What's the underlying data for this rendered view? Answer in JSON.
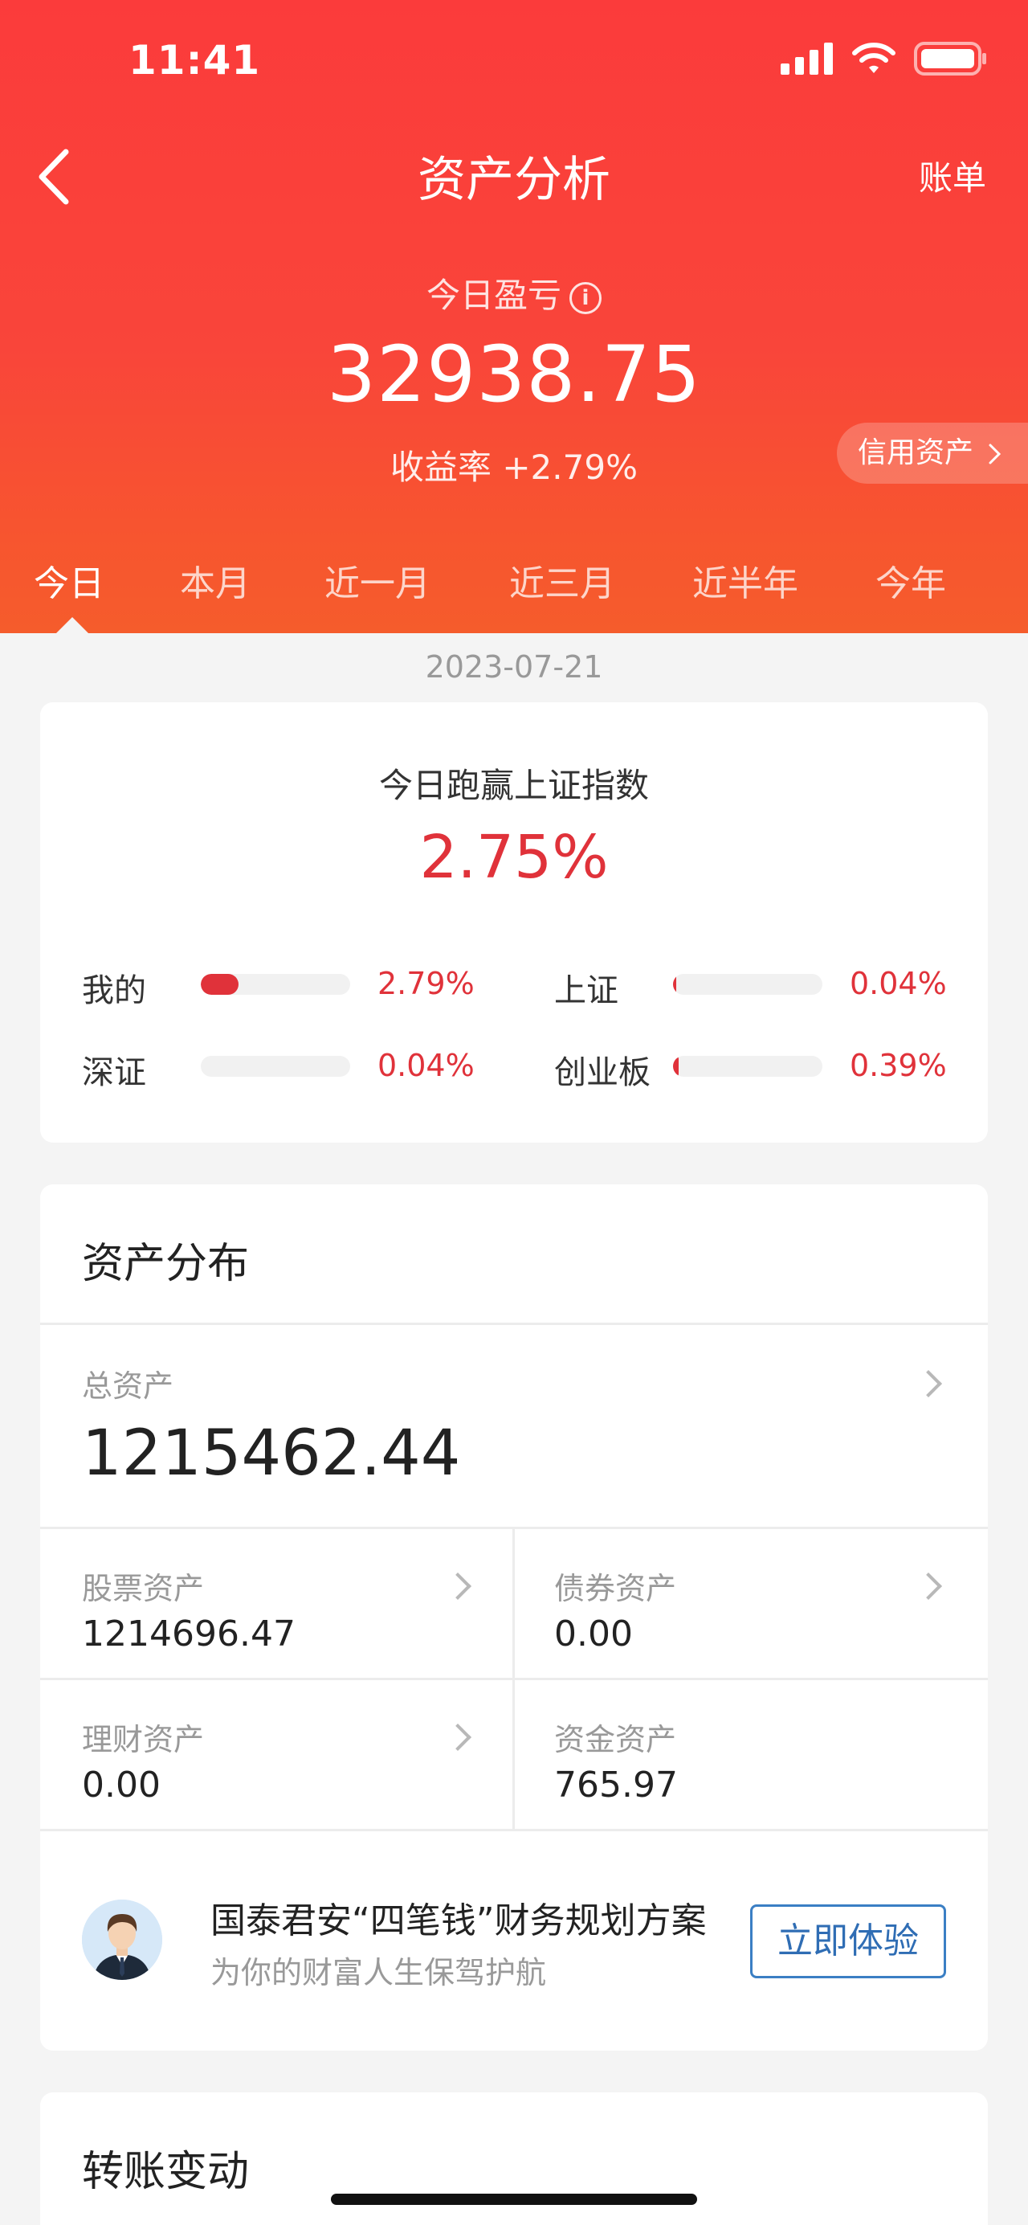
{
  "status": {
    "time": "11:41"
  },
  "header": {
    "title": "资产分析",
    "bill_link": "账单",
    "pl_label": "今日盈亏",
    "pl_value": "32938.75",
    "yield_text": "收益率 +2.79%",
    "credit_button": "信用资产"
  },
  "tabs": [
    {
      "label": "今日",
      "active": true
    },
    {
      "label": "本月"
    },
    {
      "label": "近一月"
    },
    {
      "label": "近三月"
    },
    {
      "label": "近半年"
    },
    {
      "label": "今年"
    }
  ],
  "date": "2023-07-21",
  "beat": {
    "title": "今日跑赢上证指数",
    "value": "2.75%",
    "items": [
      {
        "label": "我的",
        "value": "2.79%",
        "fill": 0.25
      },
      {
        "label": "上证",
        "value": "0.04%",
        "fill": 0.02
      },
      {
        "label": "深证",
        "value": "0.04%",
        "fill": 0.0
      },
      {
        "label": "创业板",
        "value": "0.39%",
        "fill": 0.04
      }
    ]
  },
  "assets": {
    "title": "资产分布",
    "total_label": "总资产",
    "total_value": "1215462.44",
    "cells": [
      {
        "label": "股票资产",
        "value": "1214696.47"
      },
      {
        "label": "债券资产",
        "value": "0.00"
      },
      {
        "label": "理财资产",
        "value": "0.00"
      },
      {
        "label": "资金资产",
        "value": "765.97"
      }
    ],
    "promo": {
      "title": "国泰君安“四笔钱”财务规划方案",
      "subtitle": "为你的财富人生保驾护航",
      "button": "立即体验"
    }
  },
  "transfer": {
    "title": "转账变动"
  },
  "colors": {
    "header_red": "#fb3b3b",
    "accent_red": "#e0323a",
    "link_blue": "#2f6db4"
  }
}
